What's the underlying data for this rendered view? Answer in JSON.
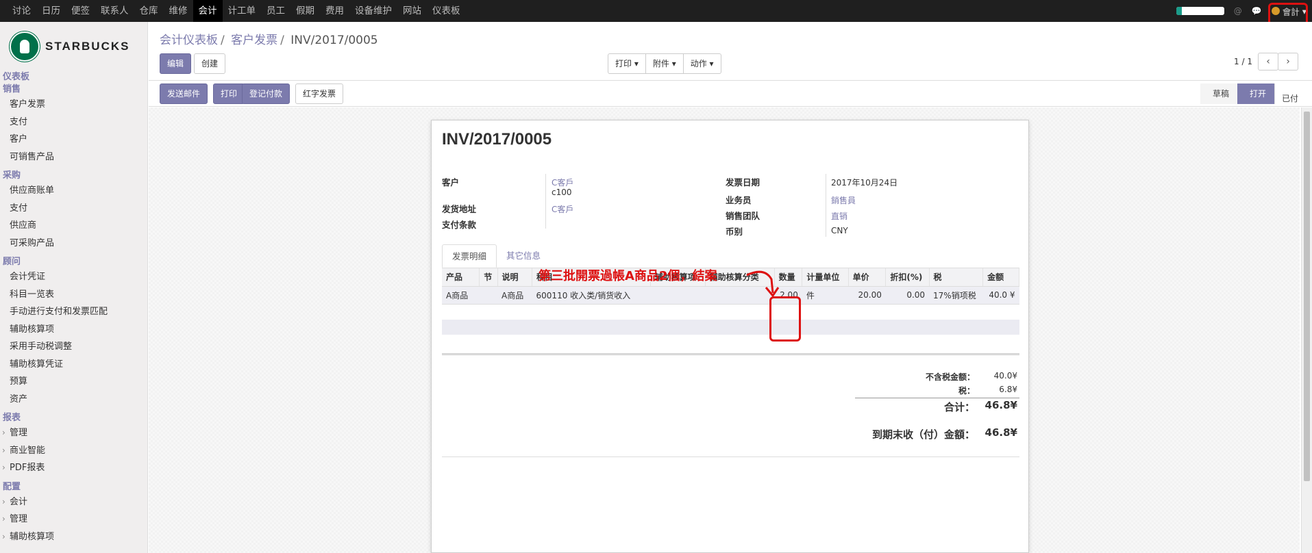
{
  "topnav": {
    "items": [
      "讨论",
      "日历",
      "便签",
      "联系人",
      "仓库",
      "维修",
      "会计",
      "计工单",
      "员工",
      "假期",
      "费用",
      "设备维护",
      "网站",
      "仪表板"
    ],
    "active_index": 6,
    "user": "會計"
  },
  "sidebar": {
    "logo_text": "STARBUCKS",
    "sections": [
      {
        "title": "仪表板",
        "items": []
      },
      {
        "title": "销售",
        "items": [
          "客户发票",
          "支付",
          "客户",
          "可销售产品"
        ]
      },
      {
        "title": "采购",
        "items": [
          "供应商账单",
          "支付",
          "供应商",
          "可采购产品"
        ]
      },
      {
        "title": "顾问",
        "items": [
          "会计凭证",
          "科目一览表",
          "手动进行支付和发票匹配",
          "辅助核算项",
          "采用手动税调整",
          "辅助核算凭证",
          "预算",
          "资产"
        ]
      },
      {
        "title": "报表",
        "items": [
          "管理",
          "商业智能",
          "PDF报表"
        ]
      },
      {
        "title": "配置",
        "items": [
          "会计",
          "管理",
          "辅助核算项"
        ]
      }
    ]
  },
  "breadcrumb": {
    "root": "会计仪表板",
    "mid": "客户发票",
    "current": "INV/2017/0005"
  },
  "toolbar": {
    "edit": "编辑",
    "create": "创建",
    "print": "打印",
    "attach": "附件",
    "action": "动作",
    "pager": "1 / 1",
    "prev": "‹",
    "next": "›"
  },
  "statusbar": {
    "buttons": [
      "发送邮件",
      "打印",
      "登记付款"
    ],
    "credit_note": "红字发票",
    "stages": [
      "草稿",
      "打开"
    ],
    "paid": "已付"
  },
  "invoice": {
    "number": "INV/2017/0005",
    "customer_label": "客户",
    "customer": "C客戶",
    "customer_ref": "c100",
    "delivery_label": "发货地址",
    "delivery": "C客戶",
    "terms_label": "支付条款",
    "date_label": "发票日期",
    "date": "2017年10月24日",
    "salesperson_label": "业务员",
    "salesperson": "銷售員",
    "team_label": "销售团队",
    "team": "直销",
    "currency_label": "币别",
    "currency": "CNY",
    "tabs": [
      "发票明细",
      "其它信息"
    ],
    "columns": [
      "产品",
      "节",
      "说明",
      "科目",
      "辅助核算项",
      "辅助核算分类",
      "数量",
      "计量单位",
      "单价",
      "折扣(%)",
      "税",
      "金额"
    ],
    "lines": [
      {
        "product": "A商品",
        "section": "",
        "description": "A商品",
        "account": "600110 收入类/销货收入",
        "analytic": "",
        "analytic_tag": "",
        "qty": "2.00",
        "uom": "件",
        "price": "20.00",
        "discount": "0.00",
        "tax": "17%销项税",
        "amount": "40.0 ¥"
      }
    ],
    "untaxed_label": "不含税金额：",
    "untaxed": "40.0¥",
    "tax_label": "税：",
    "tax": "6.8¥",
    "total_label": "合计：",
    "total": "46.8¥",
    "due_label": "到期末收（付）金額：",
    "due": "46.8¥"
  },
  "annotation": {
    "text": "第三批開票過帳A商品2個，結案",
    "color": "#dd1111"
  },
  "colors": {
    "accent": "#7c7bad",
    "topbar": "#1f1f1f"
  }
}
